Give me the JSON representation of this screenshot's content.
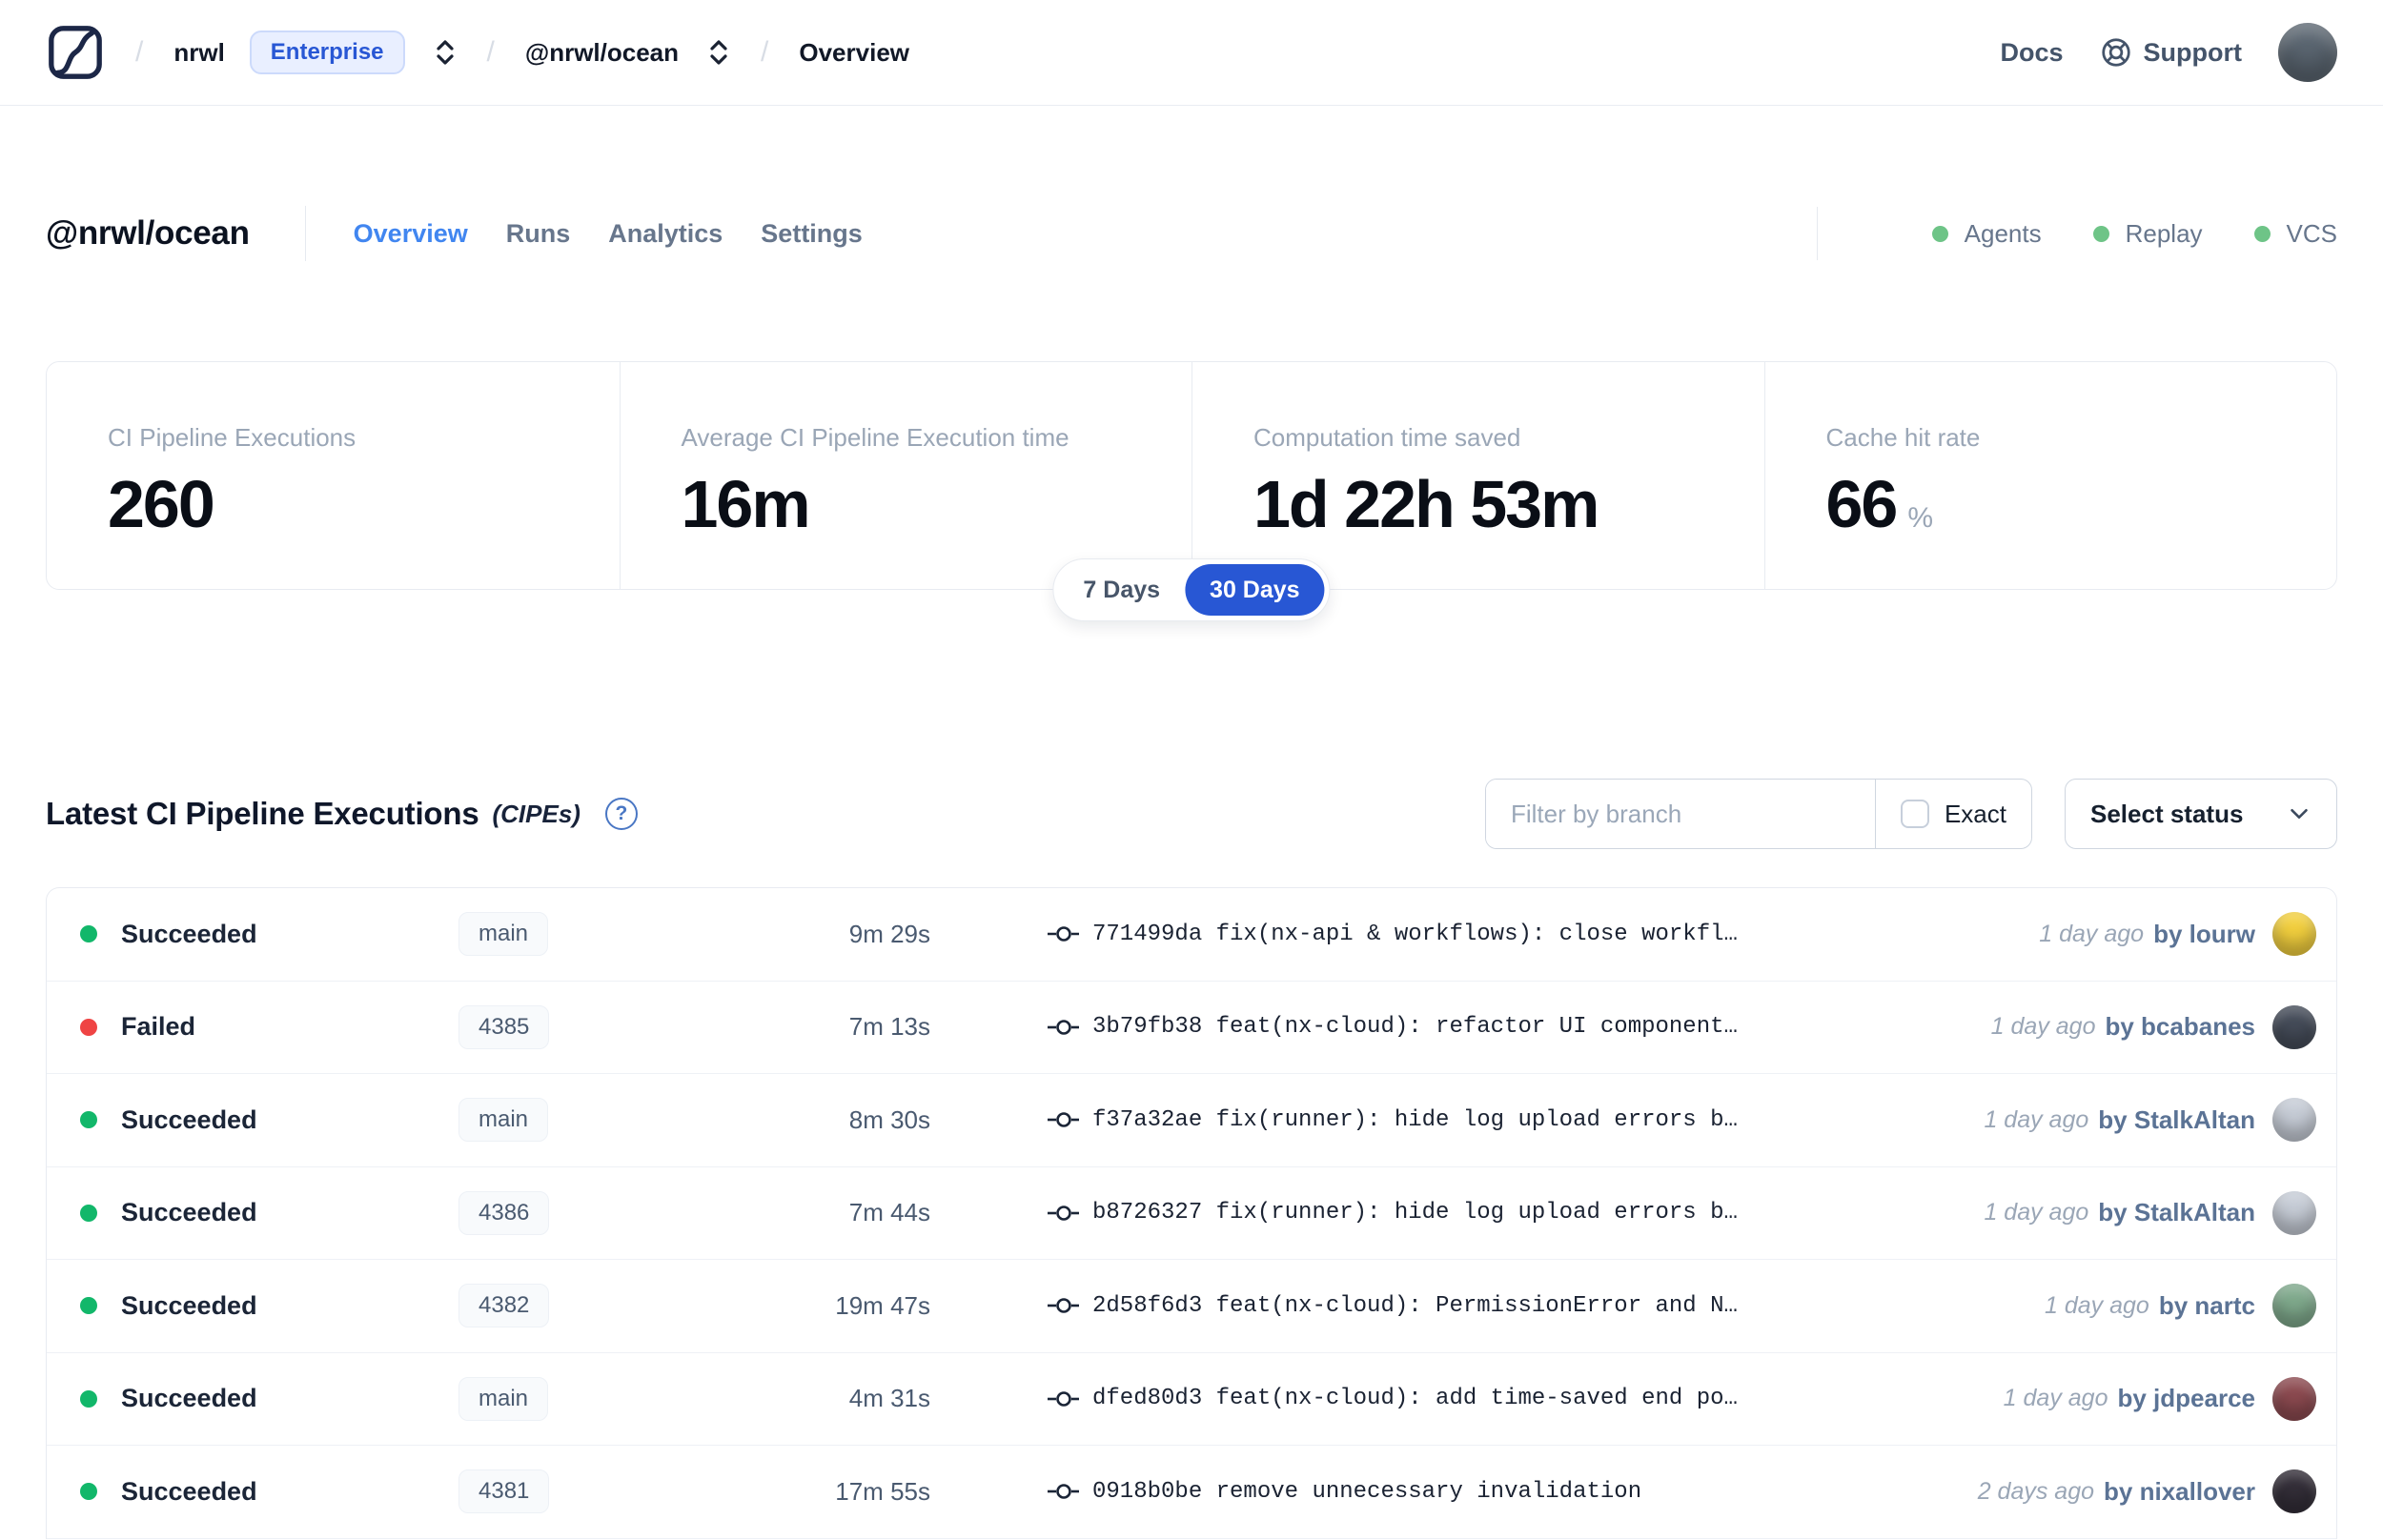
{
  "colors": {
    "accent_blue": "#2857d4",
    "link_blue": "#4186f0",
    "success_green": "#12b76a",
    "failed_red": "#ef4444",
    "indicator_green": "#6ec487"
  },
  "topnav": {
    "org": "nrwl",
    "org_badge": "Enterprise",
    "workspace": "@nrwl/ocean",
    "current_page": "Overview",
    "docs_label": "Docs",
    "support_label": "Support",
    "avatar_color": "#5a6570"
  },
  "workspace_header": {
    "title": "@nrwl/ocean",
    "tabs": [
      {
        "label": "Overview",
        "active": true
      },
      {
        "label": "Runs",
        "active": false
      },
      {
        "label": "Analytics",
        "active": false
      },
      {
        "label": "Settings",
        "active": false
      }
    ],
    "indicators": [
      {
        "label": "Agents"
      },
      {
        "label": "Replay"
      },
      {
        "label": "VCS"
      }
    ]
  },
  "stats": {
    "cards": [
      {
        "label": "CI Pipeline Executions",
        "value": "260",
        "suffix": ""
      },
      {
        "label": "Average CI Pipeline Execution time",
        "value": "16m",
        "suffix": ""
      },
      {
        "label": "Computation time saved",
        "value": "1d 22h 53m",
        "suffix": ""
      },
      {
        "label": "Cache hit rate",
        "value": "66",
        "suffix": "%"
      }
    ],
    "range_toggle": {
      "options": [
        "7 Days",
        "30 Days"
      ],
      "selected": "30 Days"
    }
  },
  "cipe_section": {
    "title": "Latest CI Pipeline Executions",
    "subtitle": "(CIPEs)",
    "help_icon": "?",
    "filter": {
      "placeholder": "Filter by branch",
      "exact_label": "Exact",
      "exact_checked": false
    },
    "status_select_label": "Select status",
    "rows": [
      {
        "status": "Succeeded",
        "dot_color": "#12b76a",
        "branch": "main",
        "duration": "9m 29s",
        "commit": "771499da fix(nx-api & workflows): close workfl…",
        "time_ago": "1 day ago",
        "author": "by lourw",
        "avatar_color": "#f2cf3e"
      },
      {
        "status": "Failed",
        "dot_color": "#ef4444",
        "branch": "4385",
        "duration": "7m 13s",
        "commit": "3b79fb38 feat(nx-cloud): refactor UI component…",
        "time_ago": "1 day ago",
        "author": "by bcabanes",
        "avatar_color": "#454c59"
      },
      {
        "status": "Succeeded",
        "dot_color": "#12b76a",
        "branch": "main",
        "duration": "8m 30s",
        "commit": "f37a32ae fix(runner): hide log upload errors b…",
        "time_ago": "1 day ago",
        "author": "by StalkAltan",
        "avatar_color": "#c6ccd6"
      },
      {
        "status": "Succeeded",
        "dot_color": "#12b76a",
        "branch": "4386",
        "duration": "7m 44s",
        "commit": "b8726327 fix(runner): hide log upload errors b…",
        "time_ago": "1 day ago",
        "author": "by StalkAltan",
        "avatar_color": "#c6ccd6"
      },
      {
        "status": "Succeeded",
        "dot_color": "#12b76a",
        "branch": "4382",
        "duration": "19m 47s",
        "commit": "2d58f6d3 feat(nx-cloud): PermissionError and N…",
        "time_ago": "1 day ago",
        "author": "by nartc",
        "avatar_color": "#7fa98c"
      },
      {
        "status": "Succeeded",
        "dot_color": "#12b76a",
        "branch": "main",
        "duration": "4m 31s",
        "commit": "dfed80d3 feat(nx-cloud): add time-saved end po…",
        "time_ago": "1 day ago",
        "author": "by jdpearce",
        "avatar_color": "#8c4a50"
      },
      {
        "status": "Succeeded",
        "dot_color": "#12b76a",
        "branch": "4381",
        "duration": "17m 55s",
        "commit": "0918b0be remove unnecessary invalidation",
        "time_ago": "2 days ago",
        "author": "by nixallover",
        "avatar_color": "#332e38"
      }
    ]
  }
}
